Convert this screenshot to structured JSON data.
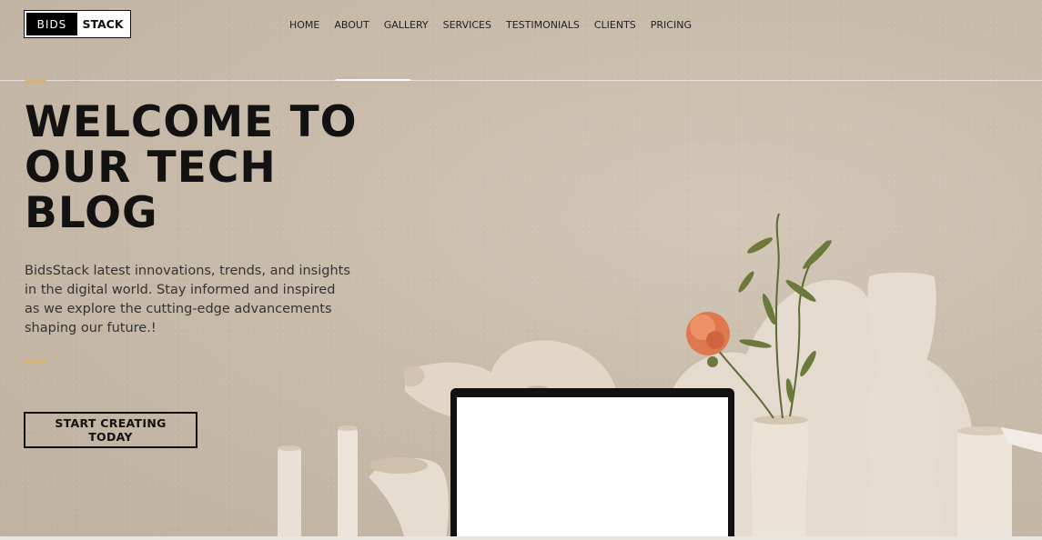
{
  "logo": {
    "part1": "BIDS",
    "part2": "STACK"
  },
  "nav": [
    {
      "label": "HOME"
    },
    {
      "label": "ABOUT"
    },
    {
      "label": "GALLERY"
    },
    {
      "label": "SERVICES"
    },
    {
      "label": "TESTIMONIALS"
    },
    {
      "label": "CLIENTS"
    },
    {
      "label": "PRICING"
    }
  ],
  "hero": {
    "title_lines": [
      "WELCOME TO",
      "OUR TECH",
      "BLOG"
    ],
    "description": "BidsStack latest innovations, trends, and insights in the digital world. Stay informed and inspired as we explore the cutting-edge advancements shaping our future.!",
    "cta_label": "START CREATING TODAY"
  },
  "colors": {
    "accent_dash": "#d7b474",
    "background": "#c8bba9",
    "text": "#121212"
  }
}
